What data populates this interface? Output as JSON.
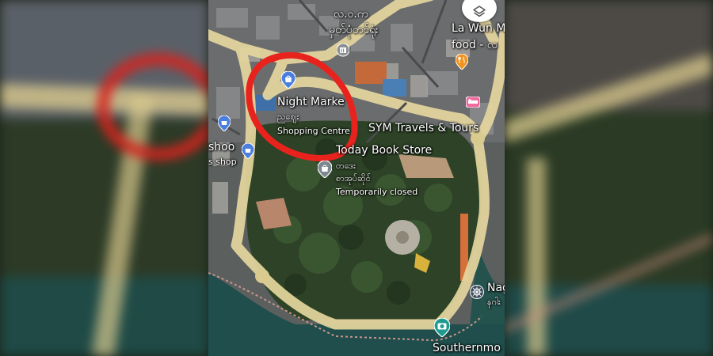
{
  "map": {
    "labels": {
      "town_name": "လ.ဝ.က",
      "town_sub": "မှတ်ပုံတင်ရုံး",
      "la_wun": "La Wun M",
      "la_wun_sub": "food - လ",
      "night_market": "Night Marke",
      "night_market_myanmar": "ညဈေး",
      "night_market_type": "Shopping Centre",
      "sym_travels": "SYM Travels & Tours",
      "shoe_shop": "shoo",
      "shoe_shop_sub": "s shop",
      "today_book_store": "Today Book Store",
      "book_store_myanmar_1": "တဒေး",
      "book_store_myanmar_2": "စာအုပ်ဆိုင်",
      "book_store_status": "Temporarily closed",
      "nag": "Nag",
      "nag_sub": "နဂါး",
      "southernmost": "Southernmo"
    },
    "icons": [
      "layers-icon",
      "shopping-bag-icon",
      "landmark-icon",
      "restaurant-icon",
      "hotel-icon",
      "store-icon",
      "pagoda-icon",
      "camera-icon"
    ],
    "colors": {
      "highlight_circle": "#e8231e",
      "road": "#efdfa4",
      "shopping_pin": "#4a7fe0",
      "restaurant_pin": "#f2921f",
      "hotel_pin": "#ef6c9f",
      "attraction_pin": "#1e9a8f"
    }
  }
}
